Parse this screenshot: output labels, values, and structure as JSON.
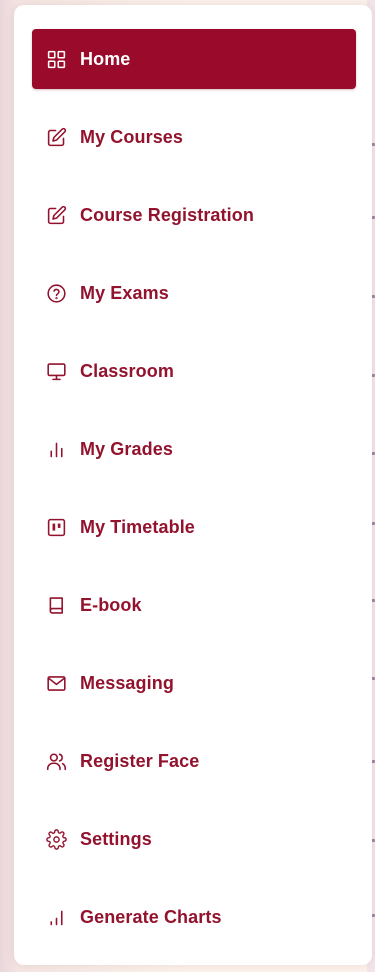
{
  "colors": {
    "accent": "#9a0a2b",
    "text": "#93132e",
    "active_text": "#ffffff",
    "connector": "#a57fa8"
  },
  "menu": {
    "items": [
      {
        "label": "Home",
        "icon": "grid-icon",
        "active": true
      },
      {
        "label": "My Courses",
        "icon": "edit-icon",
        "active": false
      },
      {
        "label": "Course Registration",
        "icon": "edit-icon",
        "active": false
      },
      {
        "label": "My Exams",
        "icon": "help-circle-icon",
        "active": false
      },
      {
        "label": "Classroom",
        "icon": "monitor-icon",
        "active": false
      },
      {
        "label": "My Grades",
        "icon": "bar-chart-icon",
        "active": false
      },
      {
        "label": "My Timetable",
        "icon": "kanban-icon",
        "active": false
      },
      {
        "label": "E-book",
        "icon": "book-icon",
        "active": false
      },
      {
        "label": "Messaging",
        "icon": "mail-icon",
        "active": false
      },
      {
        "label": "Register Face",
        "icon": "users-icon",
        "active": false
      },
      {
        "label": "Settings",
        "icon": "gear-icon",
        "active": false
      },
      {
        "label": "Generate Charts",
        "icon": "bar-chart-icon",
        "active": false
      }
    ]
  }
}
